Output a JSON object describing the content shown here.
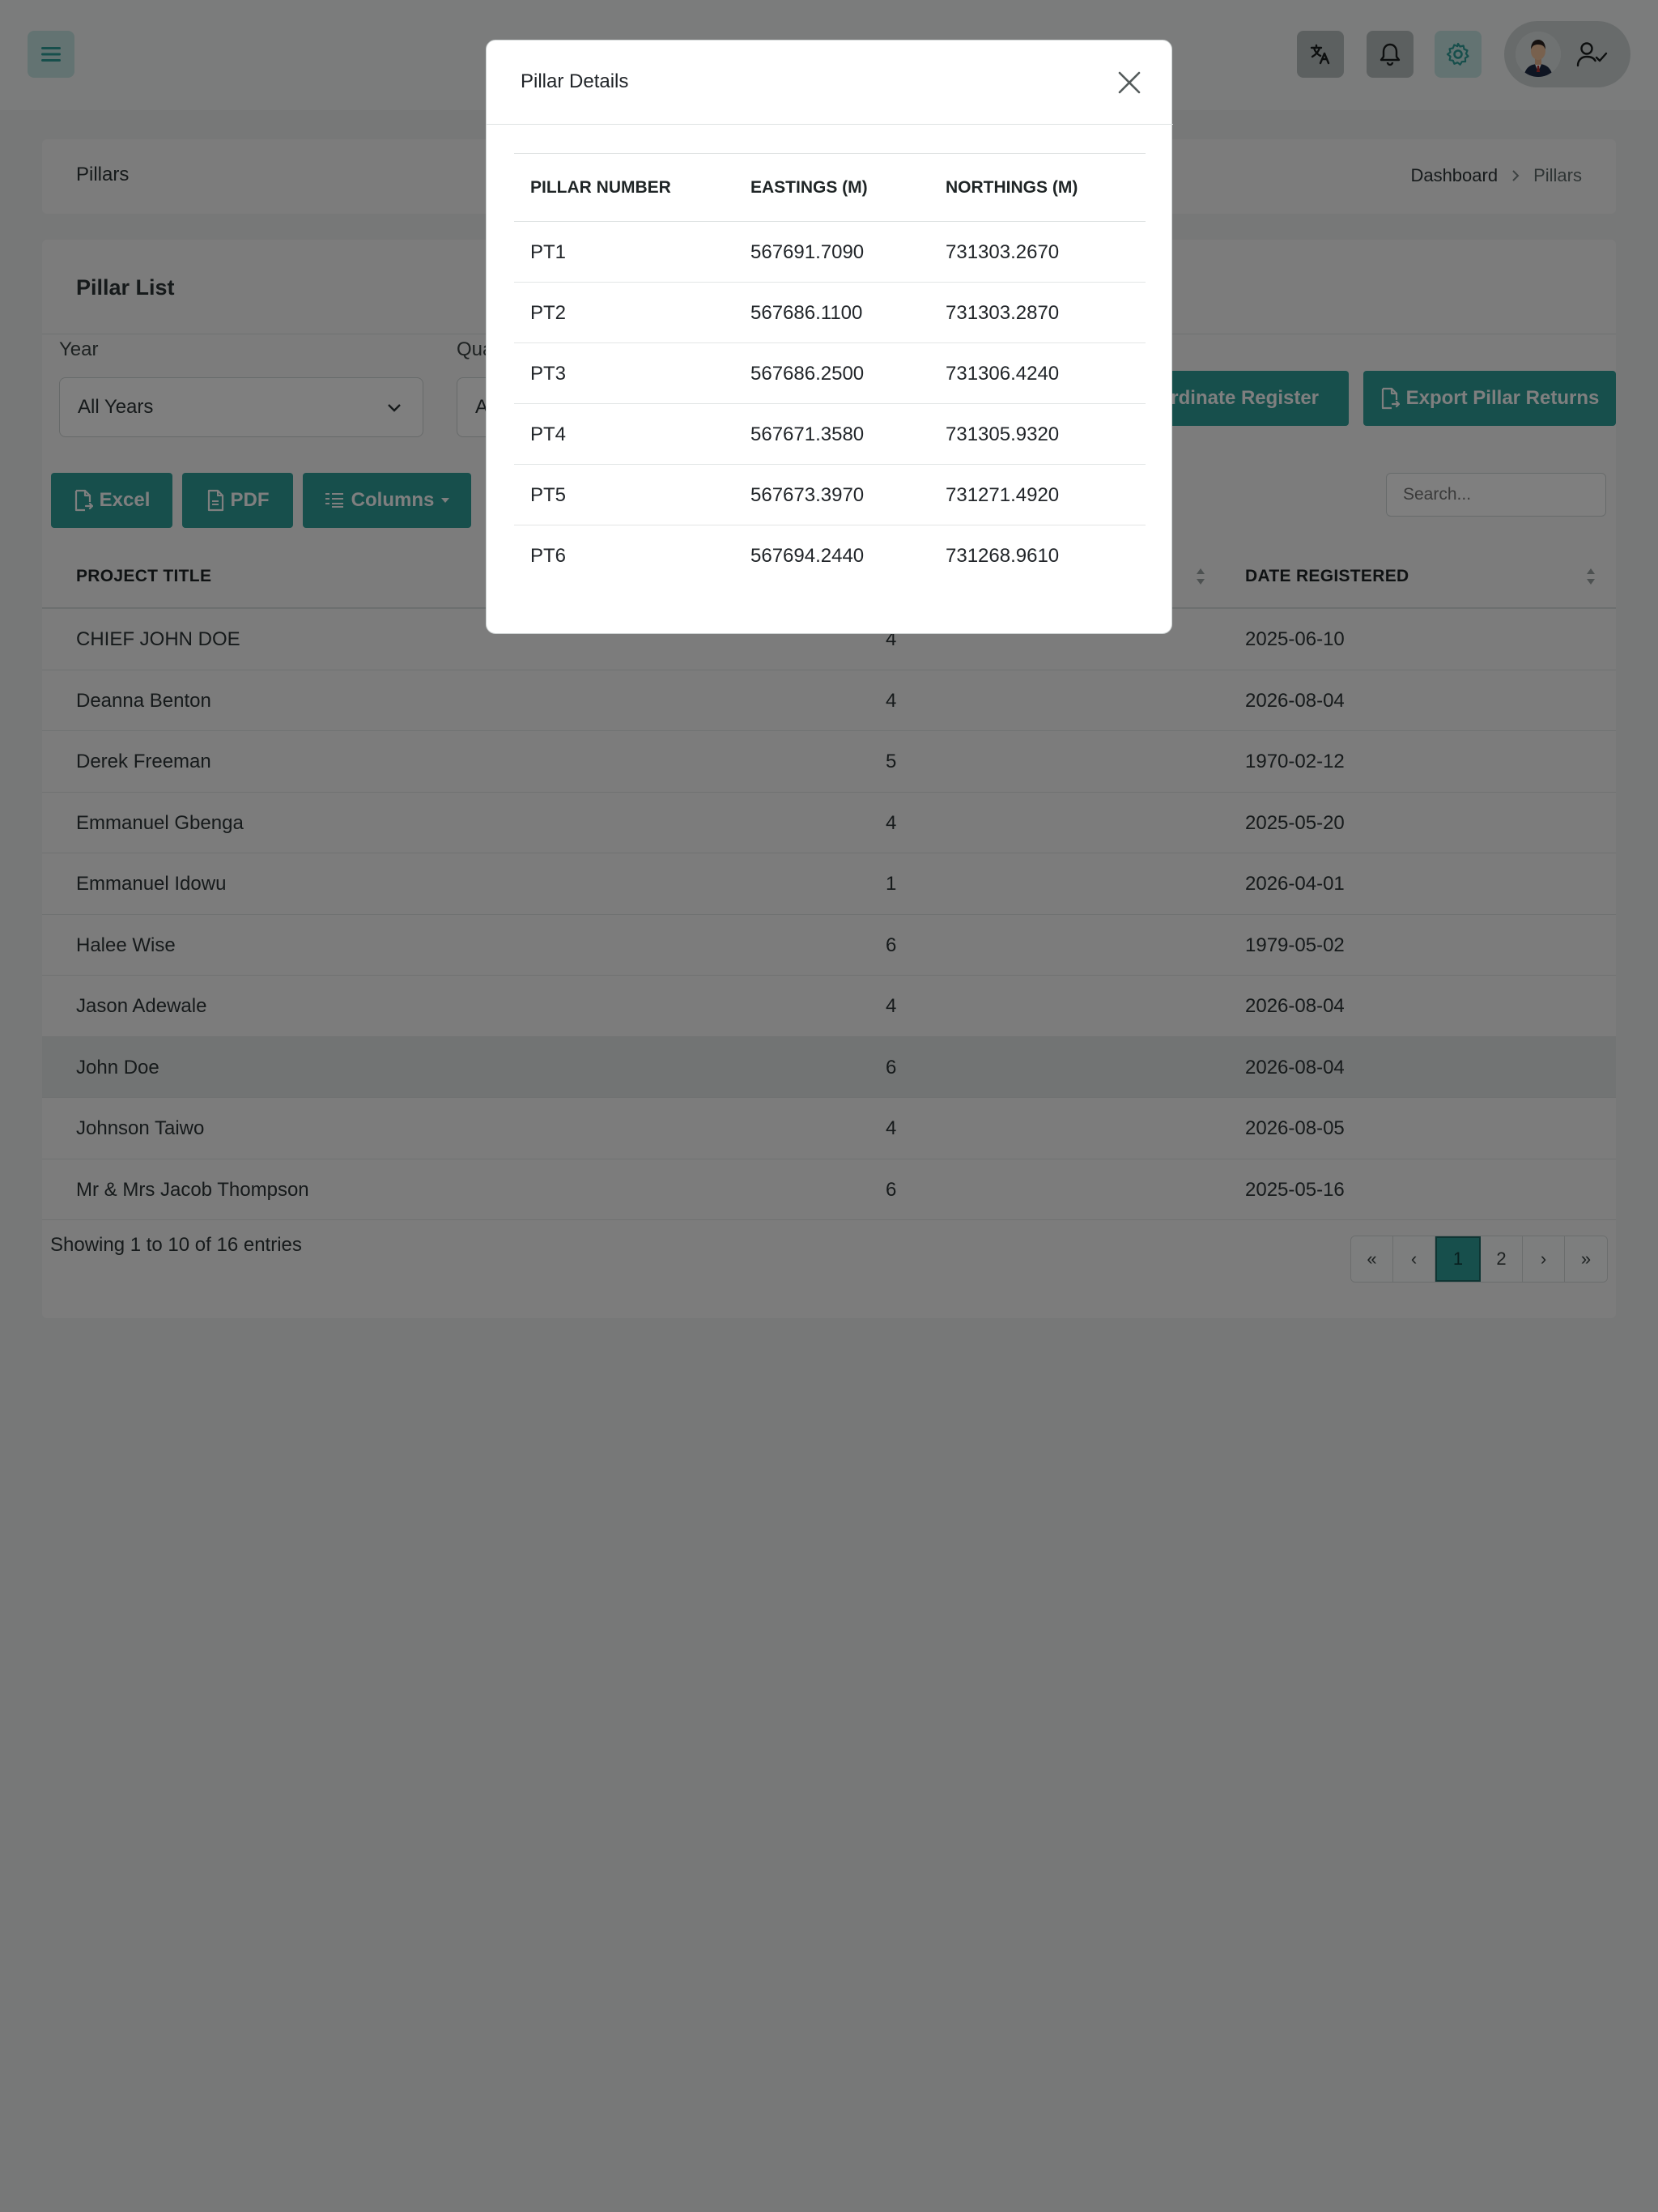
{
  "topbar": {
    "icons": {
      "menu": "menu-icon",
      "translate": "translate-icon",
      "notifications": "bell-icon",
      "settings": "gear-icon",
      "user": "user-check-icon"
    }
  },
  "header": {
    "title": "Pillars",
    "breadcrumb": [
      "Dashboard",
      "Pillars"
    ]
  },
  "pillar_list": {
    "title": "Pillar List",
    "filters": {
      "year_label": "Year",
      "year_value": "All Years",
      "quarter_label_visible": "Qua",
      "quarter_value_visible": "A"
    },
    "buttons": {
      "coordinate_register": "oordinate Register",
      "export_pillar_returns": "Export Pillar Returns",
      "excel": "Excel",
      "pdf": "PDF",
      "columns": "Columns"
    },
    "search_placeholder": "Search...",
    "columns": {
      "project_title": "PROJECT TITLE",
      "date_registered": "DATE REGISTERED"
    },
    "rows": [
      {
        "title": "CHIEF JOHN DOE",
        "count": "4",
        "date": "2025-06-10"
      },
      {
        "title": "Deanna Benton",
        "count": "4",
        "date": "2026-08-04"
      },
      {
        "title": "Derek Freeman",
        "count": "5",
        "date": "1970-02-12"
      },
      {
        "title": "Emmanuel Gbenga",
        "count": "4",
        "date": "2025-05-20"
      },
      {
        "title": "Emmanuel Idowu",
        "count": "1",
        "date": "2026-04-01"
      },
      {
        "title": "Halee Wise",
        "count": "6",
        "date": "1979-05-02"
      },
      {
        "title": "Jason Adewale",
        "count": "4",
        "date": "2026-08-04"
      },
      {
        "title": "John Doe",
        "count": "6",
        "date": "2026-08-04"
      },
      {
        "title": "Johnson Taiwo",
        "count": "4",
        "date": "2026-08-05"
      },
      {
        "title": "Mr & Mrs Jacob Thompson",
        "count": "6",
        "date": "2025-05-16"
      }
    ],
    "entries_info": "Showing 1 to 10 of 16 entries",
    "pagination": {
      "first": "«",
      "prev": "‹",
      "pages": [
        "1",
        "2"
      ],
      "active_page": "1",
      "next": "›",
      "last": "»"
    }
  },
  "modal": {
    "title": "Pillar Details",
    "columns": {
      "pillar_number": "PILLAR NUMBER",
      "eastings": "EASTINGS (M)",
      "northings": "NORTHINGS (M)"
    },
    "rows": [
      {
        "pillar": "PT1",
        "eastings": "567691.7090",
        "northings": "731303.2670"
      },
      {
        "pillar": "PT2",
        "eastings": "567686.1100",
        "northings": "731303.2870"
      },
      {
        "pillar": "PT3",
        "eastings": "567686.2500",
        "northings": "731306.4240"
      },
      {
        "pillar": "PT4",
        "eastings": "567671.3580",
        "northings": "731305.9320"
      },
      {
        "pillar": "PT5",
        "eastings": "567673.3970",
        "northings": "731271.4920"
      },
      {
        "pillar": "PT6",
        "eastings": "567694.2440",
        "northings": "731268.9610"
      }
    ]
  },
  "colors": {
    "accent": "#2f9e98",
    "overlay": "rgba(0,0,0,0.5)"
  }
}
